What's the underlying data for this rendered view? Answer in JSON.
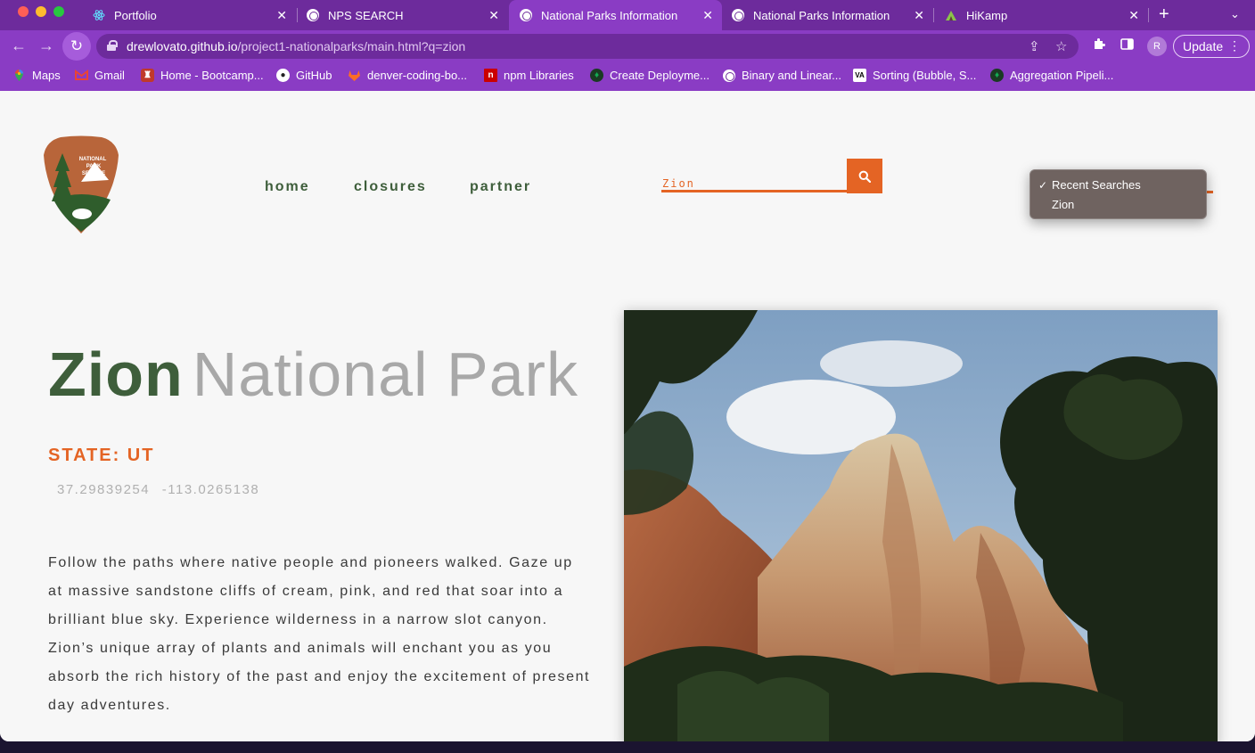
{
  "browser": {
    "tabs": [
      {
        "title": "Portfolio",
        "icon": "react-icon",
        "active": false
      },
      {
        "title": "NPS SEARCH",
        "icon": "globe-icon",
        "active": false
      },
      {
        "title": "National Parks Information",
        "icon": "globe-icon",
        "active": true
      },
      {
        "title": "National Parks Information",
        "icon": "globe-icon",
        "active": false
      },
      {
        "title": "HiKamp",
        "icon": "hikamp-icon",
        "active": false
      }
    ],
    "address": {
      "host": "drewlovato.github.io",
      "path": "/project1-nationalparks/main.html?q=zion"
    },
    "profile_initial": "R",
    "update_label": "Update",
    "bookmarks": [
      {
        "label": "Maps",
        "icon": "maps-icon"
      },
      {
        "label": "Gmail",
        "icon": "gmail-icon"
      },
      {
        "label": "Home - Bootcamp...",
        "icon": "bootcamp-icon"
      },
      {
        "label": "GitHub",
        "icon": "github-icon"
      },
      {
        "label": "denver-coding-bo...",
        "icon": "gitlab-icon"
      },
      {
        "label": "npm Libraries",
        "icon": "npm-icon"
      },
      {
        "label": "Create Deployme...",
        "icon": "mongodb-icon"
      },
      {
        "label": "Binary and Linear...",
        "icon": "globe-icon"
      },
      {
        "label": "Sorting (Bubble, S...",
        "icon": "visualgo-icon"
      },
      {
        "label": "Aggregation Pipeli...",
        "icon": "mongodb-icon"
      }
    ]
  },
  "site": {
    "nav": [
      "home",
      "closures",
      "partner"
    ],
    "search": {
      "value": "Zion"
    },
    "recent_searches": {
      "header": "Recent Searches",
      "items": [
        "Zion"
      ]
    }
  },
  "park": {
    "name": "Zion",
    "suffix": "National Park",
    "state": "STATE: UT",
    "latitude": "37.29839254",
    "longitude": "-113.0265138",
    "description": "Follow the paths where native people and pioneers walked. Gaze up at massive sandstone cliffs of cream, pink, and red that soar into a brilliant blue sky. Experience wilderness in a narrow slot canyon. Zion’s unique array of plants and animals will enchant you as you absorb the rich history of the past and enjoy the excitement of present day adventures."
  },
  "colors": {
    "chrome_dark": "#6d2b9c",
    "chrome": "#8a3cc4",
    "accent_orange": "#e46424",
    "park_green": "#3e5e3b",
    "muted_gray": "#a8a8a8"
  }
}
